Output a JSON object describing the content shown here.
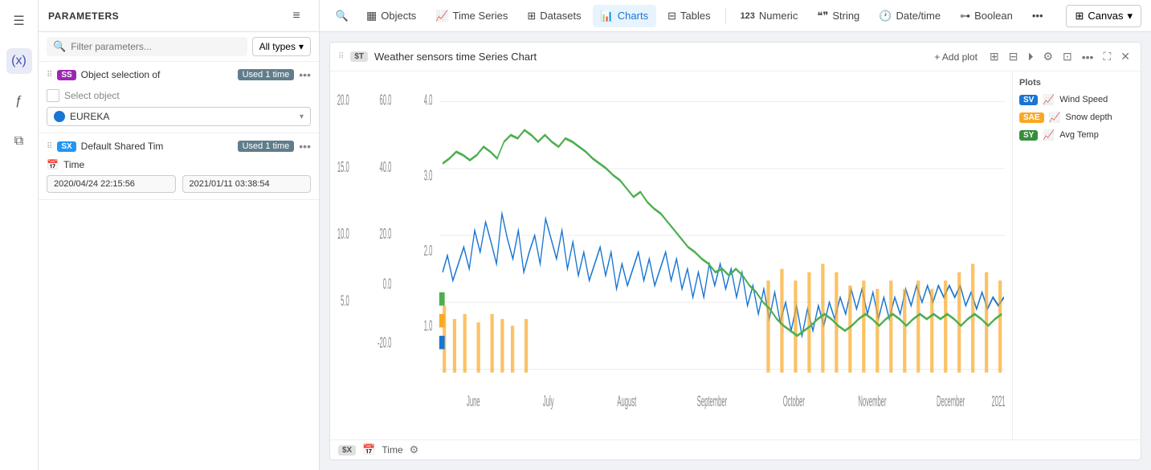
{
  "sidebar": {
    "icons": [
      {
        "name": "menu-icon",
        "glyph": "☰"
      },
      {
        "name": "variables-icon",
        "glyph": "(x)"
      },
      {
        "name": "function-icon",
        "glyph": "ƒ"
      },
      {
        "name": "layers-icon",
        "glyph": "⧉"
      }
    ]
  },
  "params_panel": {
    "title": "PARAMETERS",
    "collapse_icon": "≡",
    "search_placeholder": "Filter parameters...",
    "all_types_label": "All types",
    "object_block": {
      "drag": "⠿",
      "badge": "SS",
      "name": "Object selection of",
      "used": "Used 1 time",
      "more": "•••",
      "select_object_label": "Select object",
      "selected_object": "EUREKA",
      "dropdown_arrow": "▾"
    },
    "time_block": {
      "drag": "⠿",
      "badge": "SX",
      "name": "Default Shared Tim",
      "used": "Used 1 time",
      "more": "•••",
      "time_label": "Time",
      "time_icon": "📅",
      "start_time": "2020/04/24 22:15:56",
      "end_time": "2021/01/11 03:38:54"
    }
  },
  "topnav": {
    "search_icon": "🔍",
    "items": [
      {
        "label": "Objects",
        "icon": "▦",
        "active": false
      },
      {
        "label": "Time Series",
        "icon": "📈",
        "active": false
      },
      {
        "label": "Datasets",
        "icon": "⊞",
        "active": false
      },
      {
        "label": "Charts",
        "icon": "📊",
        "active": true
      },
      {
        "label": "Tables",
        "icon": "⊟",
        "active": false
      },
      {
        "label": "Numeric",
        "icon": "123",
        "active": false
      },
      {
        "label": "String",
        "icon": "❝❞",
        "active": false
      },
      {
        "label": "Date/time",
        "icon": "🕐",
        "active": false
      },
      {
        "label": "Boolean",
        "icon": "⊶",
        "active": false
      },
      {
        "label": "•••",
        "icon": "",
        "active": false
      }
    ],
    "canvas_label": "Canvas",
    "canvas_icon": "▾"
  },
  "chart": {
    "drag_handle": "⠿",
    "tag": "$T",
    "title": "Weather sensors time Series Chart",
    "add_plot_label": "+ Add plot",
    "header_icons": [
      "⊞",
      "⊟",
      "⏵",
      "⚙",
      "⊡",
      "•••",
      "⛶",
      "✕"
    ],
    "x_axis_labels": [
      "June",
      "July",
      "August",
      "September",
      "October",
      "November",
      "December",
      "2021"
    ],
    "y_left_labels": [
      "20.0",
      "15.0",
      "10.0",
      "5.0"
    ],
    "y_mid_labels": [
      "60.0",
      "40.0",
      "20.0",
      "0.0",
      "-20.0"
    ],
    "y_right_labels": [
      "4.0",
      "3.0",
      "2.0",
      "1.0"
    ],
    "footer": {
      "badge": "$X",
      "text": "Time",
      "settings_icon": "⚙"
    },
    "legend": {
      "title": "Plots",
      "items": [
        {
          "badge": "SV",
          "badge_class": "sv",
          "icon": "📈",
          "label": "Wind Speed"
        },
        {
          "badge": "SAE",
          "badge_class": "sae",
          "icon": "📈",
          "label": "Snow depth"
        },
        {
          "badge": "SY",
          "badge_class": "sy",
          "icon": "📈",
          "label": "Avg Temp"
        }
      ]
    }
  }
}
